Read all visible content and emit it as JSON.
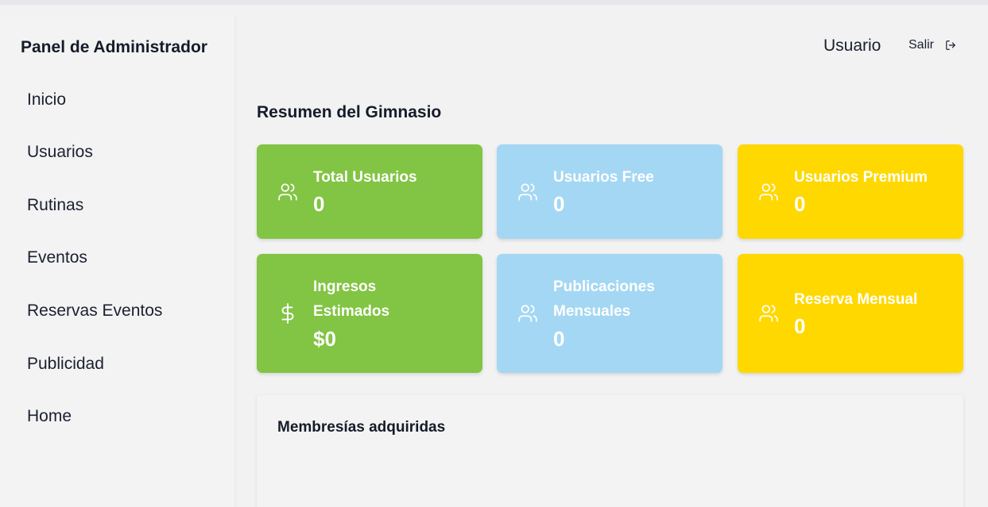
{
  "sidebar": {
    "title": "Panel de Administrador",
    "items": [
      {
        "label": "Inicio"
      },
      {
        "label": "Usuarios"
      },
      {
        "label": "Rutinas"
      },
      {
        "label": "Eventos"
      },
      {
        "label": "Reservas Eventos"
      },
      {
        "label": "Publicidad"
      },
      {
        "label": "Home"
      }
    ]
  },
  "topbar": {
    "user_label": "Usuario",
    "logout_label": "Salir",
    "logout_icon": "logout-icon"
  },
  "main": {
    "section_title": "Resumen del Gimnasio",
    "cards": [
      {
        "label_lines": [
          "Total Usuarios"
        ],
        "value": "0",
        "icon": "users-icon",
        "color": "#82c443"
      },
      {
        "label_lines": [
          "Usuarios Free"
        ],
        "value": "0",
        "icon": "users-icon",
        "color": "#a4d7f3"
      },
      {
        "label_lines": [
          "Usuarios Premium"
        ],
        "value": "0",
        "icon": "users-icon",
        "color": "#ffd800"
      },
      {
        "label_lines": [
          "Ingresos",
          "Estimados"
        ],
        "value": "$0",
        "icon": "dollar-icon",
        "color": "#82c443"
      },
      {
        "label_lines": [
          "Publicaciones",
          "Mensuales"
        ],
        "value": "0",
        "icon": "users-icon",
        "color": "#a4d7f3"
      },
      {
        "label_lines": [
          "Reserva Mensual"
        ],
        "value": "0",
        "icon": "users-icon",
        "color": "#ffd800"
      }
    ],
    "memberships_title": "Membresías adquiridas"
  }
}
